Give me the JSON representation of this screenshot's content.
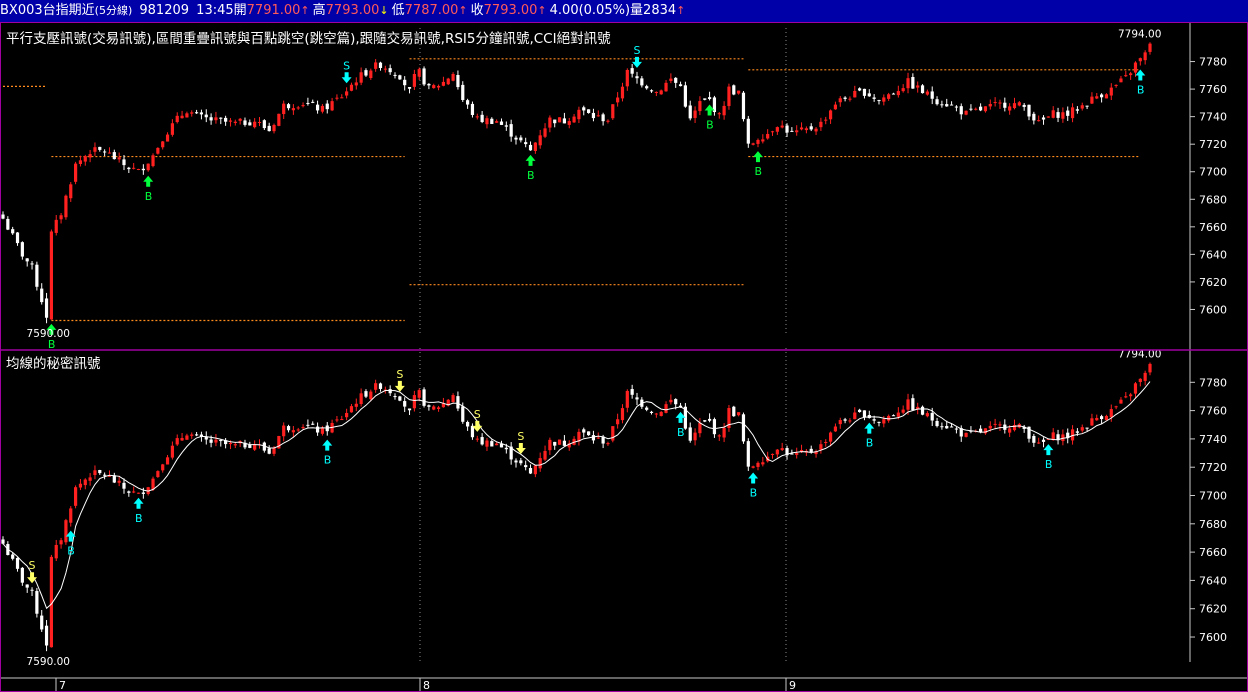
{
  "header": {
    "symbol": "BX003",
    "name": "台指期近",
    "interval": "(5分線)",
    "date": "981209",
    "time": "13:45",
    "open_label": "開",
    "open": "7791.00",
    "high_label": "高",
    "high": "7793.00",
    "low_label": "低",
    "low": "7787.00",
    "close_label": "收",
    "close": "7793.00",
    "change": "4.00(0.05%)",
    "volume_label": "量",
    "volume": "2834"
  },
  "colors": {
    "up": "#ff2020",
    "down": "#ffffff",
    "signal_buy": "#00ffff",
    "signal_buy_green": "#00ff3c",
    "signal_sell": "#ffff66",
    "ma": "#ffffff",
    "support_resistance": "#ff8a1e",
    "header_bg": "#0000a8",
    "panel_border": "#a000a0",
    "separator": "#8a8a8a"
  },
  "chart_data": [
    {
      "type": "candlestick",
      "title": "平行支壓訊號(交易訊號),區間重疊訊號與百點跳空(跳空篇),跟隨交易訊號,RSI5分鐘訊號,CCI絕對訊號",
      "y_ticks": [
        7600,
        7620,
        7640,
        7660,
        7680,
        7700,
        7720,
        7740,
        7760,
        7780
      ],
      "ylim": [
        7588,
        7800
      ],
      "max_label": "7794.00",
      "min_label": "7590.00",
      "day_labels": [
        "7",
        "8",
        "9"
      ],
      "close_path": [
        [
          0,
          7666
        ],
        [
          4,
          7640
        ],
        [
          6,
          7630
        ],
        [
          9,
          7595
        ],
        [
          10,
          7655
        ],
        [
          12,
          7670
        ],
        [
          15,
          7705
        ],
        [
          18,
          7715
        ],
        [
          21,
          7715
        ],
        [
          25,
          7705
        ],
        [
          28,
          7700
        ],
        [
          31,
          7712
        ],
        [
          33,
          7725
        ],
        [
          36,
          7738
        ],
        [
          38,
          7745
        ],
        [
          40,
          7740
        ],
        [
          44,
          7737
        ],
        [
          48,
          7735
        ],
        [
          52,
          7737
        ],
        [
          55,
          7730
        ],
        [
          58,
          7748
        ],
        [
          62,
          7750
        ],
        [
          66,
          7745
        ],
        [
          70,
          7755
        ],
        [
          73,
          7767
        ],
        [
          76,
          7775
        ],
        [
          78,
          7778
        ],
        [
          80,
          7774
        ],
        [
          82,
          7770
        ],
        [
          84,
          7758
        ],
        [
          85,
          7768
        ],
        [
          86,
          7772
        ],
        [
          88,
          7760
        ],
        [
          91,
          7765
        ],
        [
          93,
          7772
        ],
        [
          95,
          7752
        ],
        [
          98,
          7738
        ],
        [
          102,
          7737
        ],
        [
          106,
          7725
        ],
        [
          109,
          7715
        ],
        [
          111,
          7728
        ],
        [
          113,
          7738
        ],
        [
          116,
          7737
        ],
        [
          119,
          7745
        ],
        [
          122,
          7740
        ],
        [
          125,
          7738
        ],
        [
          127,
          7755
        ],
        [
          129,
          7772
        ],
        [
          132,
          7765
        ],
        [
          135,
          7758
        ],
        [
          138,
          7767
        ],
        [
          140,
          7762
        ],
        [
          142,
          7737
        ],
        [
          144,
          7750
        ],
        [
          146,
          7752
        ],
        [
          148,
          7740
        ],
        [
          150,
          7760
        ],
        [
          152,
          7757
        ],
        [
          154,
          7718
        ],
        [
          156,
          7725
        ],
        [
          158,
          7728
        ],
        [
          160,
          7735
        ],
        [
          163,
          7728
        ],
        [
          166,
          7730
        ],
        [
          169,
          7735
        ],
        [
          172,
          7750
        ],
        [
          175,
          7755
        ],
        [
          178,
          7758
        ],
        [
          181,
          7752
        ],
        [
          184,
          7758
        ],
        [
          187,
          7765
        ],
        [
          190,
          7758
        ],
        [
          193,
          7752
        ],
        [
          196,
          7748
        ],
        [
          199,
          7742
        ],
        [
          202,
          7745
        ],
        [
          205,
          7748
        ],
        [
          208,
          7750
        ],
        [
          211,
          7747
        ],
        [
          214,
          7735
        ],
        [
          217,
          7742
        ],
        [
          220,
          7742
        ],
        [
          223,
          7748
        ],
        [
          226,
          7755
        ],
        [
          229,
          7760
        ],
        [
          232,
          7768
        ],
        [
          234,
          7778
        ],
        [
          236,
          7785
        ],
        [
          237,
          7793
        ]
      ],
      "signals": [
        {
          "i": 10,
          "label": "B",
          "kind": "buy_green"
        },
        {
          "i": 30,
          "label": "B",
          "kind": "buy_green"
        },
        {
          "i": 71,
          "label": "S",
          "kind": "sell_cyan"
        },
        {
          "i": 109,
          "label": "B",
          "kind": "buy_green"
        },
        {
          "i": 131,
          "label": "S",
          "kind": "sell_cyan"
        },
        {
          "i": 146,
          "label": "B",
          "kind": "buy_green"
        },
        {
          "i": 156,
          "label": "B",
          "kind": "buy_green"
        },
        {
          "i": 235,
          "label": "B",
          "kind": "buy_cyan"
        }
      ],
      "levels": [
        {
          "value": 7762,
          "from": 0,
          "to": 9
        },
        {
          "value": 7711,
          "from": 10,
          "to": 83
        },
        {
          "value": 7592,
          "from": 10,
          "to": 83
        },
        {
          "value": 7782,
          "from": 84,
          "to": 153
        },
        {
          "value": 7618,
          "from": 84,
          "to": 153
        },
        {
          "value": 7774,
          "from": 154,
          "to": 235
        },
        {
          "value": 7711,
          "from": 154,
          "to": 235
        }
      ]
    },
    {
      "type": "candlestick",
      "title": "均線的秘密訊號",
      "y_ticks": [
        7600,
        7620,
        7640,
        7660,
        7680,
        7700,
        7720,
        7740,
        7760,
        7780
      ],
      "ylim": [
        7588,
        7800
      ],
      "max_label": "7794.00",
      "min_label": "7590.00",
      "day_labels": [
        "7",
        "8",
        "9"
      ],
      "signals": [
        {
          "i": 6,
          "label": "S",
          "kind": "sell_yellow"
        },
        {
          "i": 14,
          "label": "B",
          "kind": "buy_cyan"
        },
        {
          "i": 28,
          "label": "B",
          "kind": "buy_cyan"
        },
        {
          "i": 67,
          "label": "B",
          "kind": "buy_cyan"
        },
        {
          "i": 82,
          "label": "S",
          "kind": "sell_yellow"
        },
        {
          "i": 98,
          "label": "S",
          "kind": "sell_yellow"
        },
        {
          "i": 107,
          "label": "S",
          "kind": "sell_yellow"
        },
        {
          "i": 140,
          "label": "B",
          "kind": "buy_cyan"
        },
        {
          "i": 155,
          "label": "B",
          "kind": "buy_cyan"
        },
        {
          "i": 179,
          "label": "B",
          "kind": "buy_cyan"
        },
        {
          "i": 216,
          "label": "B",
          "kind": "buy_cyan"
        }
      ]
    }
  ]
}
